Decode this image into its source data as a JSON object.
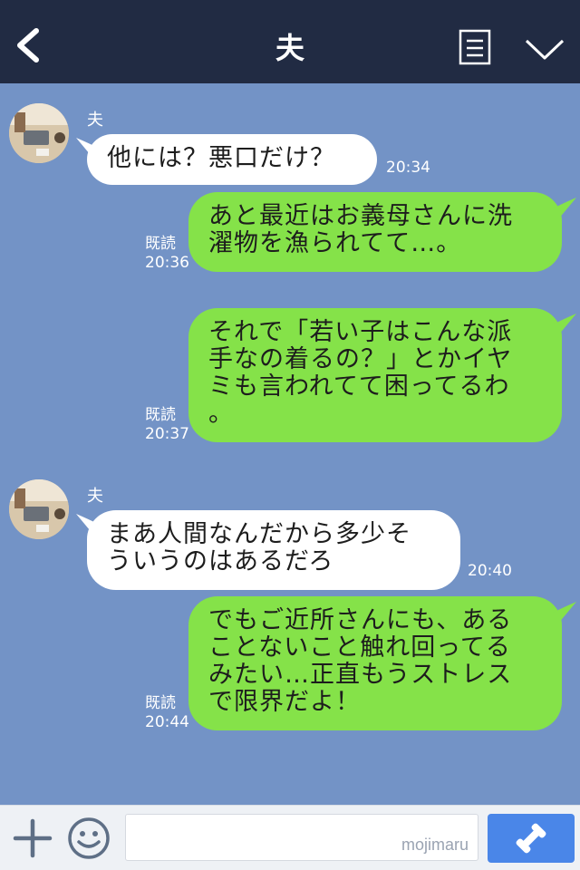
{
  "header": {
    "title": "夫"
  },
  "messages": [
    {
      "side": "in",
      "sender": "夫",
      "text": "他には？悪口だけ？",
      "time": "20:34"
    },
    {
      "side": "out",
      "lines": [
        "あと最近はお義母さんに洗",
        "濯物を漁られてて…。"
      ],
      "read": "既読",
      "time": "20:36"
    },
    {
      "side": "out",
      "lines": [
        "それで「若い子はこんな派",
        "手なの着るの？」とかイヤ",
        "ミも言われてて困ってるわ",
        "。"
      ],
      "read": "既読",
      "time": "20:37"
    },
    {
      "side": "in",
      "sender": "夫",
      "lines": [
        "まあ人間なんだから多少そ",
        "ういうのはあるだろ"
      ],
      "time": "20:40"
    },
    {
      "side": "out",
      "lines": [
        "でもご近所さんにも、ある",
        "ことないこと触れ回ってる",
        "みたい…正直もうストレス",
        "で限界だよ！"
      ],
      "read": "既読",
      "time": "20:44"
    }
  ],
  "footer": {
    "watermark": "mojimaru"
  },
  "colors": {
    "header": "#212b43",
    "background": "#7393c6",
    "outgoing_bubble": "#85e249",
    "incoming_bubble": "#ffffff",
    "send_button": "#4a86e8"
  },
  "icons": [
    "back-arrow-icon",
    "memo-icon",
    "chevron-down-icon",
    "plus-icon",
    "emoji-icon",
    "phone-icon"
  ]
}
